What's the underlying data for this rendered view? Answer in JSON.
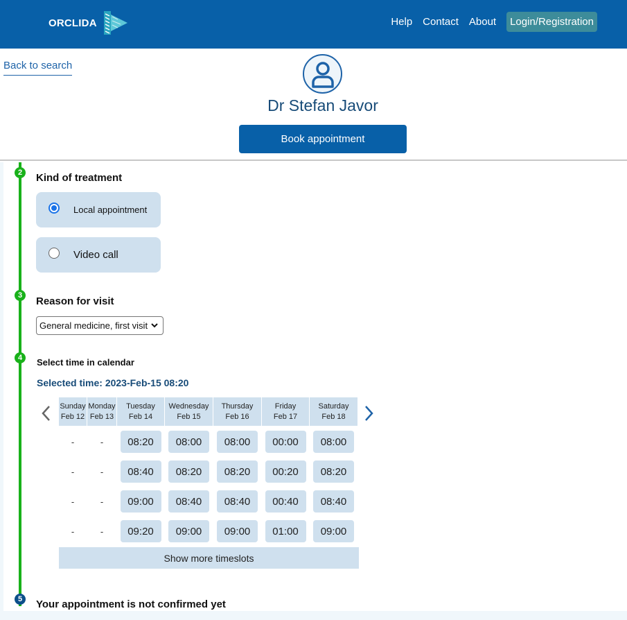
{
  "brand": {
    "name": "ORCLIDA",
    "logo_icon": "orclida-logo-icon"
  },
  "nav": {
    "help": "Help",
    "contact": "Contact",
    "about": "About",
    "login": "Login/Registration"
  },
  "header": {
    "back_link": "Back to search",
    "avatar_icon": "user-avatar-icon",
    "doctor_name": "Dr Stefan Javor",
    "book_button": "Book appointment"
  },
  "steps": {
    "treatment": {
      "number": "2",
      "title": "Kind of treatment",
      "options": [
        "Local appointment",
        "Video call"
      ],
      "selected": "Local appointment"
    },
    "reason": {
      "number": "3",
      "title": "Reason for visit",
      "selected_value": "General medicine, first visit"
    },
    "calendar": {
      "number": "4",
      "title": "Select time in calendar",
      "selected_time": "Selected time: 2023-Feb-15 08:20"
    },
    "confirm": {
      "number": "5",
      "title": "Your appointment is not confirmed yet"
    }
  },
  "calendar": {
    "days": [
      {
        "name": "Sunday",
        "date": "Feb 12",
        "slots": [
          "-",
          "-",
          "-",
          "-"
        ]
      },
      {
        "name": "Monday",
        "date": "Feb 13",
        "slots": [
          "-",
          "-",
          "-",
          "-"
        ]
      },
      {
        "name": "Tuesday",
        "date": "Feb 14",
        "slots": [
          "08:20",
          "08:40",
          "09:00",
          "09:20"
        ]
      },
      {
        "name": "Wednesday",
        "date": "Feb 15",
        "slots": [
          "08:00",
          "08:20",
          "08:40",
          "09:00"
        ]
      },
      {
        "name": "Thursday",
        "date": "Feb 16",
        "slots": [
          "08:00",
          "08:20",
          "08:40",
          "09:00"
        ]
      },
      {
        "name": "Friday",
        "date": "Feb 17",
        "slots": [
          "00:00",
          "00:20",
          "00:40",
          "01:00"
        ]
      },
      {
        "name": "Saturday",
        "date": "Feb 18",
        "slots": [
          "08:00",
          "08:20",
          "08:40",
          "09:00"
        ]
      }
    ],
    "show_more": "Show more timeslots"
  },
  "colors": {
    "primary": "#0860a8",
    "accent_teal": "#3d8c9a",
    "slot_bg": "#cfe0ee",
    "timeline_green": "#19b11a",
    "step5_blue": "#0c4f8a"
  }
}
